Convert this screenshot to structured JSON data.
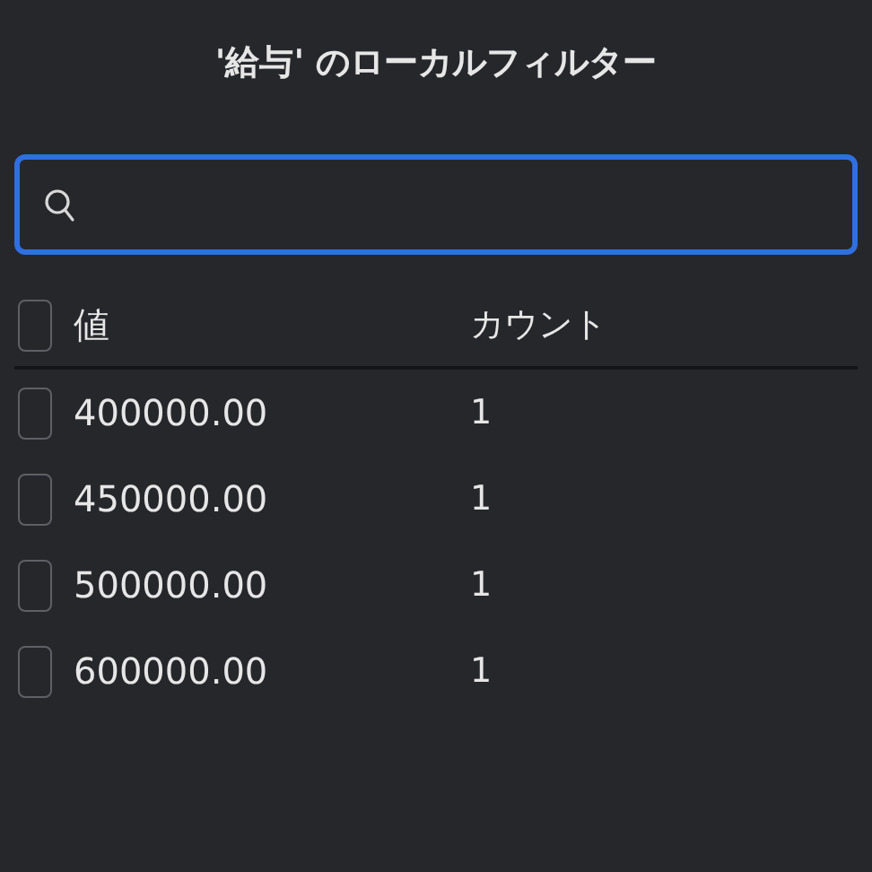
{
  "title": "'給与' のローカルフィルター",
  "search": {
    "focused": true
  },
  "table": {
    "select_all": {
      "checked": false
    },
    "columns": [
      "値",
      "カウント"
    ],
    "rows": [
      {
        "value": "400000.00",
        "count": "1",
        "checked": false
      },
      {
        "value": "450000.00",
        "count": "1",
        "checked": false
      },
      {
        "value": "500000.00",
        "count": "1",
        "checked": false
      },
      {
        "value": "600000.00",
        "count": "1",
        "checked": false
      }
    ]
  }
}
